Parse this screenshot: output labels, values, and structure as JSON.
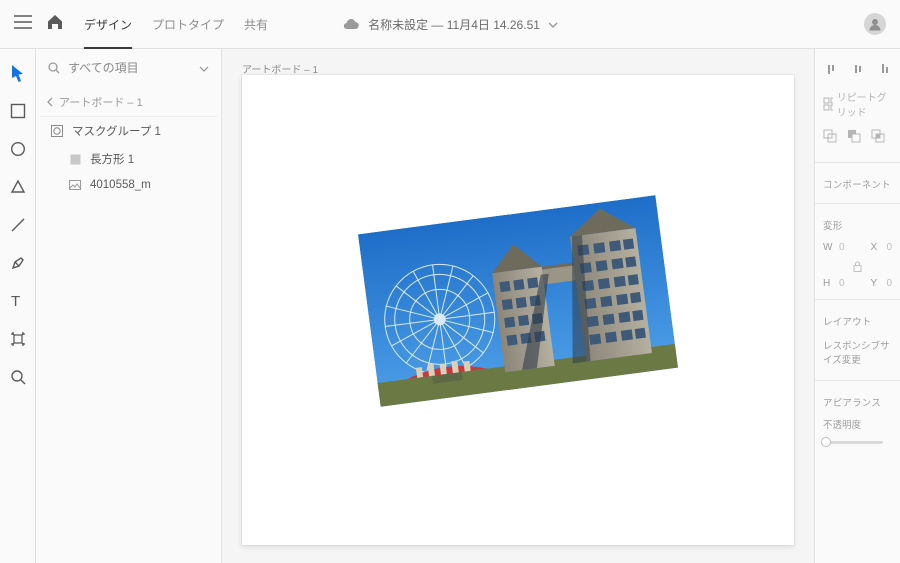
{
  "topbar": {
    "tabs": [
      "デザイン",
      "プロトタイプ",
      "共有"
    ],
    "activeTab": 0,
    "docTitle": "名称未設定 — 11月4日 14.26.51"
  },
  "layers": {
    "search": {
      "placeholder": "すべての項目"
    },
    "breadcrumb": "アートボード – 1",
    "items": [
      {
        "kind": "mask",
        "label": "マスクグループ 1",
        "indent": 0
      },
      {
        "kind": "rect",
        "label": "長方形 1",
        "indent": 1
      },
      {
        "kind": "image",
        "label": "4010558_m",
        "indent": 1
      }
    ]
  },
  "canvas": {
    "artboardLabel": "アートボード – 1"
  },
  "inspector": {
    "repeatGrid": "リピートグリッド",
    "componentSection": "コンポーネント",
    "transformSection": "変形",
    "transform": {
      "wLabel": "W",
      "wValue": "0",
      "xLabel": "X",
      "xValue": "0",
      "hLabel": "H",
      "hValue": "0",
      "yLabel": "Y",
      "yValue": "0"
    },
    "layoutSection": "レイアウト",
    "responsive": "レスポンシブサイズ変更",
    "appearanceSection": "アピアランス",
    "opacityLabel": "不透明度"
  }
}
